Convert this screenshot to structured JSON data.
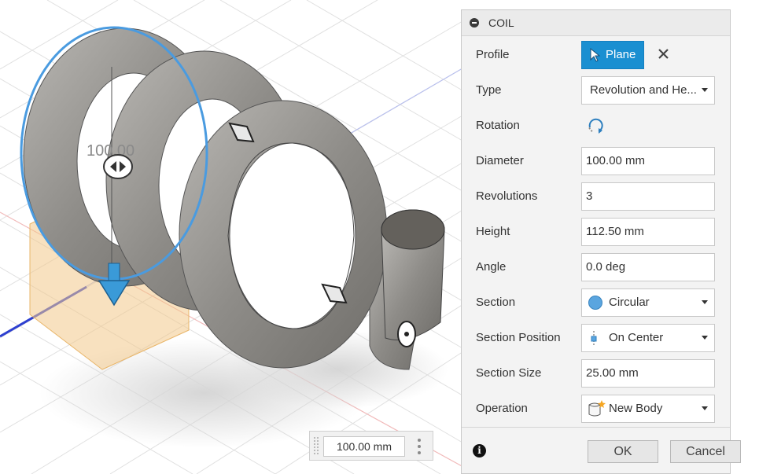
{
  "viewport": {
    "dimension_label": "100.00"
  },
  "dialog": {
    "title": "COIL",
    "fields": {
      "profile": {
        "label": "Profile",
        "value": "Plane"
      },
      "type": {
        "label": "Type",
        "value": "Revolution and He..."
      },
      "rotation": {
        "label": "Rotation"
      },
      "diameter": {
        "label": "Diameter",
        "value": "100.00 mm"
      },
      "revolutions": {
        "label": "Revolutions",
        "value": "3"
      },
      "height": {
        "label": "Height",
        "value": "112.50 mm"
      },
      "angle": {
        "label": "Angle",
        "value": "0.0 deg"
      },
      "section": {
        "label": "Section",
        "value": "Circular"
      },
      "section_position": {
        "label": "Section Position",
        "value": "On Center"
      },
      "section_size": {
        "label": "Section Size",
        "value": "25.00 mm"
      },
      "operation": {
        "label": "Operation",
        "value": "New Body"
      }
    },
    "ok_label": "OK",
    "cancel_label": "Cancel"
  },
  "value_input": {
    "value": "100.00 mm"
  },
  "colors": {
    "accent": "#1a8fd1",
    "coil_body": "#9a9894",
    "selection_ring": "#4a9be0",
    "plane_highlight": "#f2c98a"
  },
  "icons": [
    "collapse-icon",
    "cursor-icon",
    "close-icon",
    "rotation-icon",
    "circle-icon",
    "center-icon",
    "new-body-icon",
    "info-icon",
    "more-icon",
    "grip-icon"
  ]
}
